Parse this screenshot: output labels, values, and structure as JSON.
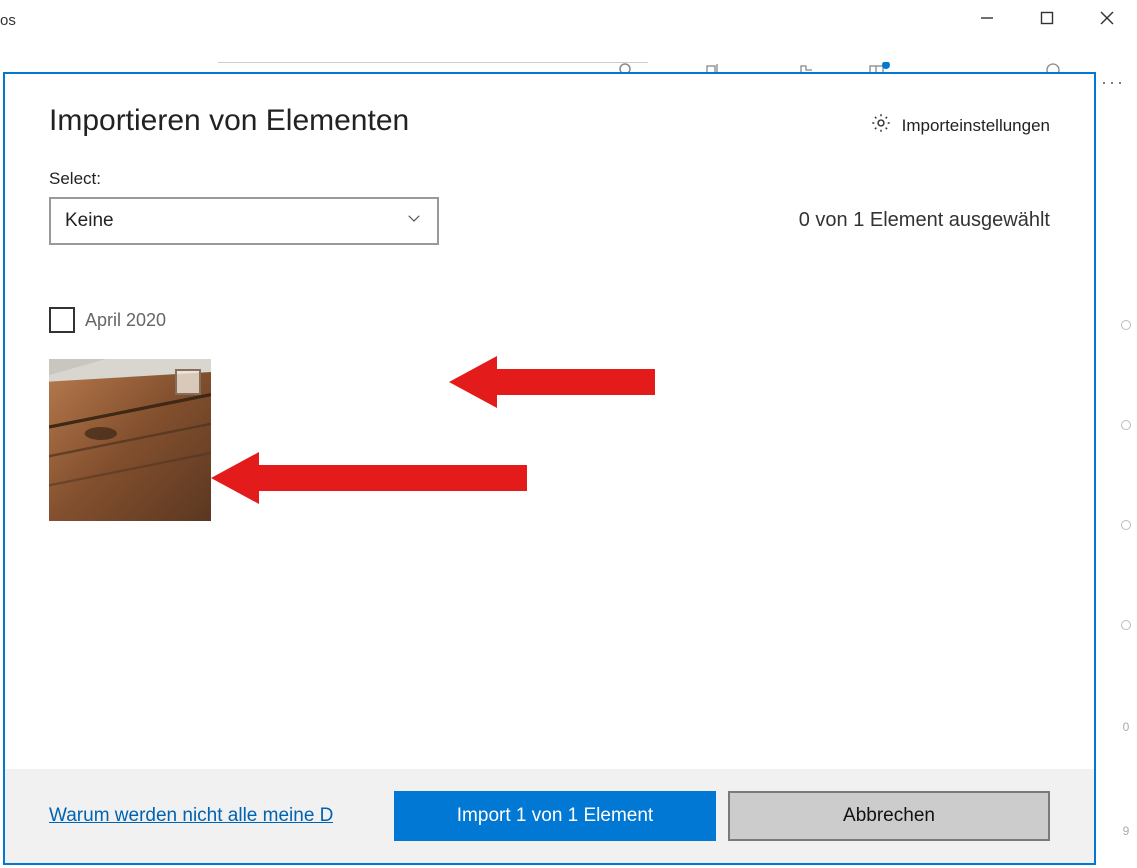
{
  "window": {
    "app_title_partial": "os",
    "controls": {
      "minimize": "—",
      "maximize": "▢",
      "close": "✕"
    },
    "more_menu": "···"
  },
  "dialog": {
    "title": "Importieren von Elementen",
    "settings_label": "Importeinstellungen",
    "select_label": "Select:",
    "select_value": "Keine",
    "selection_count": "0 von 1 Element ausgewählt",
    "group_label": "April 2020",
    "footer_link": "Warum werden nicht alle meine D",
    "import_button": "Import 1 von 1 Element",
    "cancel_button": "Abbrechen"
  },
  "icons": {
    "gear": "gear-icon",
    "chevron": "chevron-down-icon",
    "minimize": "minimize-icon",
    "maximize": "maximize-icon",
    "close": "close-icon"
  },
  "sidebar_hints": {
    "numbers": [
      "0",
      "9"
    ]
  }
}
